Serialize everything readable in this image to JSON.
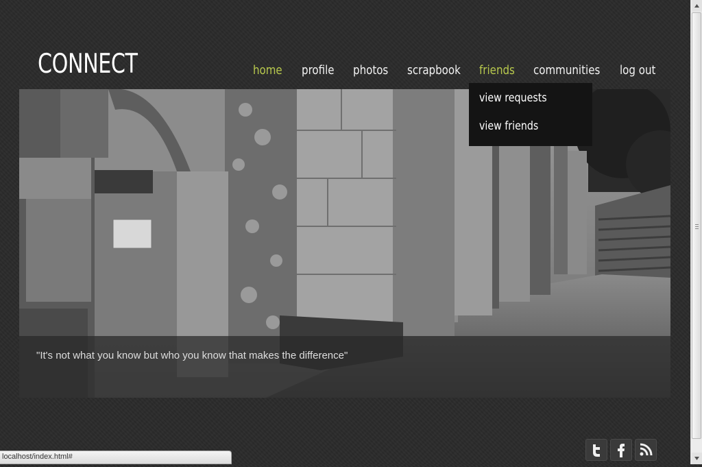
{
  "site": {
    "logo": "CONNECT"
  },
  "nav": {
    "items": [
      {
        "label": "home",
        "active": true
      },
      {
        "label": "profile",
        "active": false
      },
      {
        "label": "photos",
        "active": false
      },
      {
        "label": "scrapbook",
        "active": false
      },
      {
        "label": "friends",
        "active": true
      },
      {
        "label": "communities",
        "active": false
      },
      {
        "label": "log out",
        "active": false
      }
    ]
  },
  "dropdown": {
    "items": [
      "view requests",
      "view friends"
    ]
  },
  "hero": {
    "quote": "\"It's not what you know but who you know that makes the difference\""
  },
  "social": {
    "icons": [
      "twitter-icon",
      "facebook-icon",
      "rss-icon"
    ]
  },
  "statusbar": {
    "url": "localhost/index.html#"
  },
  "colors": {
    "accent": "#b7c84d",
    "background": "#2b2b2b",
    "dropdown": "#141414"
  }
}
